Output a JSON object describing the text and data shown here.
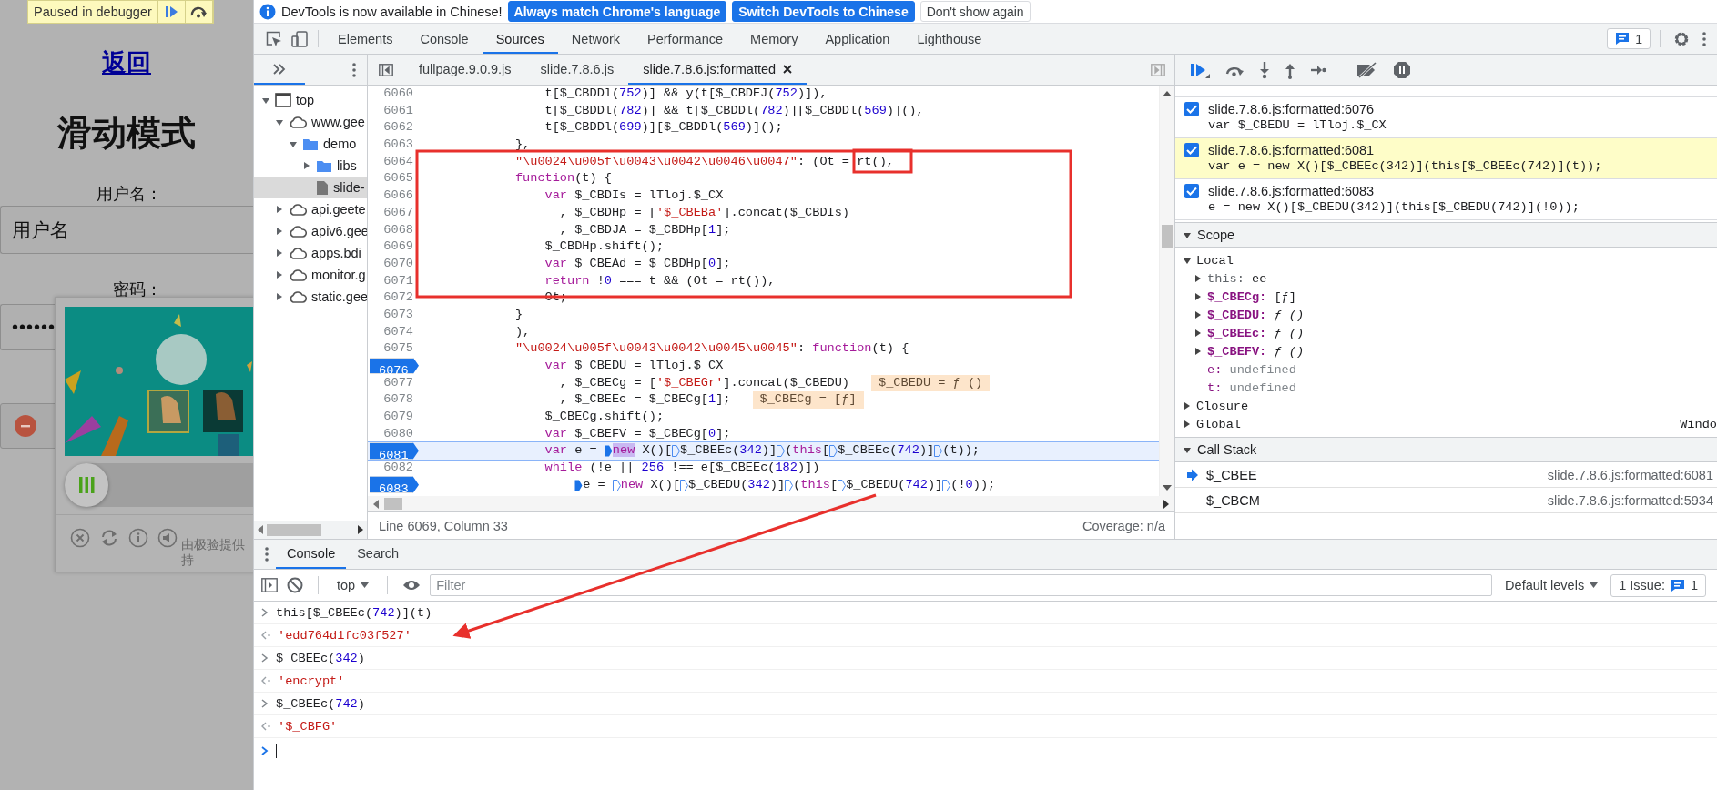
{
  "page": {
    "paused_badge": "Paused in debugger",
    "back_link": "返回",
    "heading": "滑动模式",
    "username_label": "用户名：",
    "username_field": {
      "value": "用户名"
    },
    "password_label": "密码：",
    "password_field": {
      "value": "••••••"
    },
    "captcha": {
      "picture": {
        "kind": "picture"
      },
      "slider": {
        "level": 0
      },
      "footer_text": [
        "由极验提供",
        "持"
      ]
    }
  },
  "devtools": {
    "infobar": {
      "message": "DevTools is now available in Chinese!",
      "buttons": [
        {
          "label": "Always match Chrome's language",
          "kind": "primary"
        },
        {
          "label": "Switch DevTools to Chinese",
          "kind": "primary"
        },
        {
          "label": "Don't show again",
          "kind": "secondary"
        }
      ]
    },
    "tabs": [
      {
        "label": "Elements",
        "selected": false
      },
      {
        "label": "Console",
        "selected": false
      },
      {
        "label": "Sources",
        "selected": true
      },
      {
        "label": "Network",
        "selected": false
      },
      {
        "label": "Performance",
        "selected": false
      },
      {
        "label": "Memory",
        "selected": false
      },
      {
        "label": "Application",
        "selected": false
      },
      {
        "label": "Lighthouse",
        "selected": false
      }
    ],
    "issues_count": "1",
    "navigator": {
      "tree": [
        {
          "label": "top",
          "kind": "frame",
          "expanded": true,
          "selected": false,
          "children": [
            {
              "label": "www.gee",
              "kind": "domain",
              "expanded": true,
              "selected": false,
              "children": [
                {
                  "label": "demo",
                  "kind": "folder",
                  "expanded": true,
                  "selected": false,
                  "children": [
                    {
                      "label": "libs",
                      "kind": "folder",
                      "expanded": false,
                      "selected": false
                    },
                    {
                      "label": "slide-",
                      "kind": "file",
                      "selected": true
                    }
                  ]
                }
              ]
            },
            {
              "label": "api.geete",
              "kind": "domain",
              "expanded": false,
              "selected": false
            },
            {
              "label": "apiv6.gee",
              "kind": "domain",
              "expanded": false,
              "selected": false
            },
            {
              "label": "apps.bdi",
              "kind": "domain",
              "expanded": false,
              "selected": false
            },
            {
              "label": "monitor.g",
              "kind": "domain",
              "expanded": false,
              "selected": false
            },
            {
              "label": "static.gee",
              "kind": "domain",
              "expanded": false,
              "selected": false
            }
          ]
        }
      ]
    },
    "editor_tabs": [
      {
        "label": "fullpage.9.0.9.js",
        "selected": false
      },
      {
        "label": "slide.7.8.6.js",
        "selected": false
      },
      {
        "label": "slide.7.8.6.js:formatted",
        "selected": true
      }
    ],
    "code_lines": [
      {
        "number": "6060",
        "breakpoint": false,
        "current": false,
        "parts": [
          "                t[$_CBDDl(",
          {
            "kind": "num",
            "text": "752"
          },
          ")] && y(t[$_CBDEJ(",
          {
            "kind": "num",
            "text": "752"
          },
          ")]),"
        ]
      },
      {
        "number": "6061",
        "breakpoint": false,
        "current": false,
        "parts": [
          "                t[$_CBDDl(",
          {
            "kind": "num",
            "text": "782"
          },
          ")] && t[$_CBDDl(",
          {
            "kind": "num",
            "text": "782"
          },
          ")][$_CBDDl(",
          {
            "kind": "num",
            "text": "569"
          },
          ")](),"
        ]
      },
      {
        "number": "6062",
        "breakpoint": false,
        "current": false,
        "parts": [
          "                t[$_CBDDl(",
          {
            "kind": "num",
            "text": "699"
          },
          ")][$_CBDDl(",
          {
            "kind": "num",
            "text": "569"
          },
          ")]();"
        ]
      },
      {
        "number": "6063",
        "breakpoint": false,
        "current": false,
        "parts": [
          "            },"
        ]
      },
      {
        "number": "6064",
        "breakpoint": false,
        "current": false,
        "parts": [
          {
            "kind": "str",
            "text": "            \"\\u0024\\u005f\\u0043\\u0042\\u0046\\u0047\""
          },
          ": (Ot = rt(),"
        ]
      },
      {
        "number": "6065",
        "breakpoint": false,
        "current": false,
        "parts": [
          {
            "kind": "kw",
            "text": "            function"
          },
          "(t) {"
        ]
      },
      {
        "number": "6066",
        "breakpoint": false,
        "current": false,
        "parts": [
          {
            "kind": "kw",
            "text": "                var"
          },
          " $_CBDIs = lTloj.$_CX"
        ]
      },
      {
        "number": "6067",
        "breakpoint": false,
        "current": false,
        "parts": [
          "                  , $_CBDHp = [",
          {
            "kind": "str",
            "text": "'$_CBEBa'"
          },
          "].concat($_CBDIs)"
        ]
      },
      {
        "number": "6068",
        "breakpoint": false,
        "current": false,
        "parts": [
          "                  , $_CBDJA = $_CBDHp[",
          {
            "kind": "num",
            "text": "1"
          },
          "];"
        ]
      },
      {
        "number": "6069",
        "breakpoint": false,
        "current": false,
        "parts": [
          "                $_CBDHp.shift();"
        ]
      },
      {
        "number": "6070",
        "breakpoint": false,
        "current": false,
        "parts": [
          {
            "kind": "kw",
            "text": "                var"
          },
          " $_CBEAd = $_CBDHp[",
          {
            "kind": "num",
            "text": "0"
          },
          "];"
        ]
      },
      {
        "number": "6071",
        "breakpoint": false,
        "current": false,
        "parts": [
          {
            "kind": "kw",
            "text": "                return"
          },
          " !",
          {
            "kind": "num",
            "text": "0"
          },
          " === t && (Ot = rt()),"
        ]
      },
      {
        "number": "6072",
        "breakpoint": false,
        "current": false,
        "parts": [
          "                Ot;"
        ]
      },
      {
        "number": "6073",
        "breakpoint": false,
        "current": false,
        "parts": [
          "            }"
        ]
      },
      {
        "number": "6074",
        "breakpoint": false,
        "current": false,
        "parts": [
          "            ),"
        ]
      },
      {
        "number": "6075",
        "breakpoint": false,
        "current": false,
        "parts": [
          {
            "kind": "str",
            "text": "            \"\\u0024\\u005f\\u0043\\u0042\\u0045\\u0045\""
          },
          ": ",
          {
            "kind": "kw",
            "text": "function"
          },
          "(t) {"
        ]
      },
      {
        "number": "6076",
        "breakpoint": true,
        "current": false,
        "parts": [
          {
            "kind": "kw",
            "text": "                var"
          },
          " $_CBEDU = lTloj.$_CX"
        ]
      },
      {
        "number": "6077",
        "breakpoint": false,
        "current": false,
        "parts": [
          "                  , $_CBECg = [",
          {
            "kind": "str",
            "text": "'$_CBEGr'"
          },
          "].concat($_CBEDU)"
        ],
        "inline_value": "$_CBEDU = ƒ ()"
      },
      {
        "number": "6078",
        "breakpoint": false,
        "current": false,
        "parts": [
          "                  , $_CBEEc = $_CBECg[",
          {
            "kind": "num",
            "text": "1"
          },
          "];"
        ],
        "inline_value": "$_CBECg = [ƒ]"
      },
      {
        "number": "6079",
        "breakpoint": false,
        "current": false,
        "parts": [
          "                $_CBECg.shift();"
        ]
      },
      {
        "number": "6080",
        "breakpoint": false,
        "current": false,
        "parts": [
          {
            "kind": "kw",
            "text": "                var"
          },
          " $_CBEFV = $_CBECg[",
          {
            "kind": "num",
            "text": "0"
          },
          "];"
        ]
      },
      {
        "number": "6081",
        "breakpoint": true,
        "current": true,
        "parts": [
          {
            "kind": "kw",
            "text": "                var"
          },
          " e = ",
          {
            "kind": "marker",
            "active": true
          },
          {
            "kind": "selection",
            "text": "new"
          },
          " X()[",
          {
            "kind": "marker",
            "active": false
          },
          "$_CBEEc(",
          {
            "kind": "num",
            "text": "342"
          },
          ")]",
          {
            "kind": "marker",
            "active": false
          },
          "(",
          {
            "kind": "kw",
            "text": "this"
          },
          "[",
          {
            "kind": "marker",
            "active": false
          },
          "$_CBEEc(",
          {
            "kind": "num",
            "text": "742"
          },
          ")]",
          {
            "kind": "marker",
            "active": false
          },
          "(t));"
        ]
      },
      {
        "number": "6082",
        "breakpoint": false,
        "current": false,
        "parts": [
          {
            "kind": "kw",
            "text": "                while"
          },
          " (!e || ",
          {
            "kind": "num",
            "text": "256"
          },
          " !== e[$_CBEEc(",
          {
            "kind": "num",
            "text": "182"
          },
          ")])"
        ]
      },
      {
        "number": "6083",
        "breakpoint": true,
        "current": false,
        "parts": [
          {
            "kind": "marker",
            "active": true
          },
          "                    e = ",
          {
            "kind": "marker",
            "active": false
          },
          {
            "kind": "kw",
            "text": "new"
          },
          " X()[",
          {
            "kind": "marker",
            "active": false
          },
          "$_CBEDU(",
          {
            "kind": "num",
            "text": "342"
          },
          ")]",
          {
            "kind": "marker",
            "active": false
          },
          "(",
          {
            "kind": "kw",
            "text": "this"
          },
          "[",
          {
            "kind": "marker",
            "active": false
          },
          "$_CBEDU(",
          {
            "kind": "num",
            "text": "742"
          },
          ")]",
          {
            "kind": "marker",
            "active": false
          },
          "(!",
          {
            "kind": "num",
            "text": "0"
          },
          "));"
        ]
      }
    ],
    "status": {
      "position": "Line 6069, Column 33",
      "coverage": "Coverage: n/a"
    },
    "debugger": {
      "breakpoints": [
        {
          "location": "slide.7.8.6.js:formatted:6076",
          "code": "var $_CBEDU = lTloj.$_CX",
          "checked": true,
          "paused": false
        },
        {
          "location": "slide.7.8.6.js:formatted:6081",
          "code": "var e = new X()[$_CBEEc(342)](this[$_CBEEc(742)](t));",
          "checked": true,
          "paused": true
        },
        {
          "location": "slide.7.8.6.js:formatted:6083",
          "code": "e = new X()[$_CBEDU(342)](this[$_CBEDU(742)](!0));",
          "checked": true,
          "paused": false
        }
      ],
      "scope": {
        "title": "Scope",
        "expanded": true,
        "sections": [
          {
            "name": "Local",
            "expanded": true,
            "vars": [
              {
                "name": "this:",
                "value": "ee",
                "kind": "receiver",
                "expandable": true
              },
              {
                "name": "$_CBECg:",
                "value": "[ƒ]",
                "kind": "object",
                "expandable": true
              },
              {
                "name": "$_CBEDU:",
                "value": "ƒ ()",
                "kind": "function",
                "expandable": true
              },
              {
                "name": "$_CBEEc:",
                "value": "ƒ ()",
                "kind": "function",
                "expandable": true
              },
              {
                "name": "$_CBEFV:",
                "value": "ƒ ()",
                "kind": "function",
                "expandable": true
              },
              {
                "name": "e:",
                "value": "undefined",
                "kind": "undefined",
                "expandable": false
              },
              {
                "name": "t:",
                "value": "undefined",
                "kind": "undefined",
                "expandable": false
              }
            ]
          },
          {
            "name": "Closure",
            "expanded": false
          },
          {
            "name": "Global",
            "expanded": false,
            "value": "Windo"
          }
        ]
      },
      "call_stack": {
        "title": "Call Stack",
        "expanded": true,
        "frames": [
          {
            "name": "$_CBEE",
            "location": "slide.7.8.6.js:formatted:6081",
            "current": true
          },
          {
            "name": "$_CBCM",
            "location": "slide.7.8.6.js:formatted:5934",
            "current": false
          }
        ]
      }
    },
    "drawer": {
      "tabs": [
        {
          "label": "Console",
          "selected": true
        },
        {
          "label": "Search",
          "selected": false
        }
      ],
      "context": "top",
      "filter_placeholder": "Filter",
      "levels": "Default levels",
      "issues_label": "1 Issue:",
      "issues_count": "1",
      "entries": [
        {
          "kind": "input",
          "parts": [
            "this[$_CBEEc(",
            {
              "kind": "num",
              "text": "742"
            },
            ")](t)"
          ]
        },
        {
          "kind": "output",
          "text": "'edd764d1fc03f527'"
        },
        {
          "kind": "input",
          "parts": [
            "$_CBEEc(",
            {
              "kind": "num",
              "text": "342"
            },
            ")"
          ]
        },
        {
          "kind": "output",
          "text": "'encrypt'"
        },
        {
          "kind": "input",
          "parts": [
            "$_CBEEc(",
            {
              "kind": "num",
              "text": "742"
            },
            ")"
          ]
        },
        {
          "kind": "output",
          "text": "'$_CBFG'"
        }
      ]
    }
  }
}
